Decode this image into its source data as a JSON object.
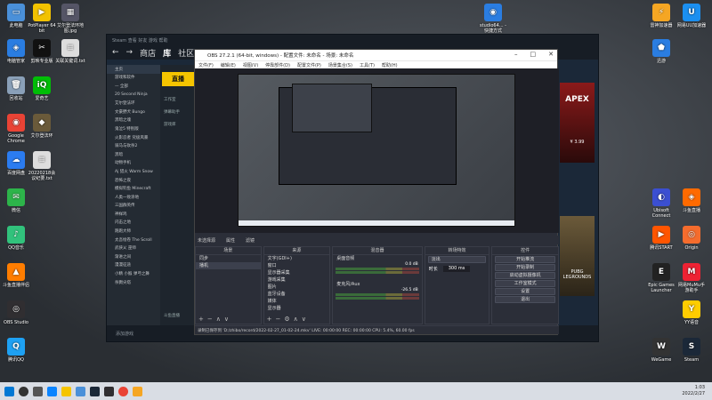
{
  "desktop_left": [
    {
      "label": "此电脑",
      "color": "#4a90d9",
      "glyph": "▭"
    },
    {
      "label": "电脑管家",
      "color": "#2a7de1",
      "glyph": "◈"
    },
    {
      "label": "回收站",
      "color": "#8aa0b8",
      "glyph": "🗑"
    },
    {
      "label": "Google Chrome",
      "color": "#e94335",
      "glyph": "◉"
    },
    {
      "label": "百度网盘",
      "color": "#2b7cf0",
      "glyph": "☁"
    },
    {
      "label": "微信",
      "color": "#2db44a",
      "glyph": "✉"
    },
    {
      "label": "QQ音乐",
      "color": "#31c27c",
      "glyph": "♪"
    },
    {
      "label": "斗鱼直播伴侣",
      "color": "#ff7d00",
      "glyph": "▲"
    },
    {
      "label": "OBS Studio",
      "color": "#302e31",
      "glyph": "◎"
    },
    {
      "label": "腾讯QQ",
      "color": "#1ea1f3",
      "glyph": "Q"
    }
  ],
  "desktop_col2": [
    {
      "label": "PotPlayer 64 bit",
      "color": "#f2c200",
      "glyph": "▶"
    },
    {
      "label": "剪映专业版",
      "color": "#111",
      "glyph": "✂"
    },
    {
      "label": "爱奇艺",
      "color": "#00be06",
      "glyph": "iQ"
    },
    {
      "label": "艾尔登法环",
      "color": "#6a5a3a",
      "glyph": "◆"
    },
    {
      "label": "20220218会议纪要.txt",
      "color": "#ddd",
      "glyph": "≡"
    }
  ],
  "desktop_col3": [
    {
      "label": "艾尔登法环地图.jpg",
      "color": "#556",
      "glyph": "▦"
    },
    {
      "label": "关联关键词.txt",
      "color": "#ddd",
      "glyph": "≡"
    }
  ],
  "desktop_right": [
    {
      "label": "雷神加速器",
      "color": "#f5a623",
      "glyph": "⚡"
    },
    {
      "label": "网易UU加速器",
      "color": "#1b8ff0",
      "glyph": "U"
    },
    {
      "label": "迅游",
      "color": "#2a7de1",
      "glyph": "⬟"
    },
    {
      "label": "Ubisoft Connect",
      "color": "#3b4fd1",
      "glyph": "◐"
    },
    {
      "label": "斗鱼直播",
      "color": "#ff6a00",
      "glyph": "◈"
    },
    {
      "label": "腾讯START",
      "color": "#ff5500",
      "glyph": "▶"
    },
    {
      "label": "Origin",
      "color": "#f56c2d",
      "glyph": "◎"
    },
    {
      "label": "Epic Games Launcher",
      "color": "#222",
      "glyph": "E"
    },
    {
      "label": "网易MuMu手游助手",
      "color": "#e23",
      "glyph": "M"
    },
    {
      "label": "YY语音",
      "color": "#ffcc00",
      "glyph": "Y"
    },
    {
      "label": "WeGame",
      "color": "#333",
      "glyph": "W"
    },
    {
      "label": "Steam",
      "color": "#1b2838",
      "glyph": "S"
    }
  ],
  "desktop_top_mid": {
    "label": "studio64... - 快捷方式"
  },
  "steam": {
    "nav": [
      "←",
      "→",
      "商店",
      "库",
      "社区"
    ],
    "home": "主页",
    "filter": "游戏和软件",
    "all_label": "— 全部",
    "games": [
      "20 Second Ninja",
      "艾尔登法环",
      "文豪野犬 Bungo",
      "黑暗之魂",
      "鬼泣5 特别版",
      "火影忍者 究极风暴",
      "骑马与砍杀2",
      "黑暗",
      "动物手机",
      "Aj 猎火 Warm Snow",
      "恐怖之夜",
      "模拟钓鱼 Minecraft",
      "人类一败涂地",
      "三国群英传",
      "神样鸡",
      "闪击之地",
      "跑跑大师",
      "太吾绘卷 The Scroll",
      "武侠乂 巫师",
      "渐进之间",
      "漫漫征途",
      "小精 小猴 弹弓之舞",
      "杀戮尖塔"
    ],
    "mid_items": [
      "直播",
      "工作室",
      "弹幕助手",
      "游戏库",
      "斗鱼直播"
    ],
    "bottom": "添加游戏",
    "ad_title": "APEX",
    "ad_price": "¥ 3.99",
    "ad_sub": "PUBG LEGROUNDS"
  },
  "obs": {
    "title": "OBS 27.2.1 (64-bit, windows) - 配置文件: 未命名 - 场景: 未命名",
    "menu": [
      "文件(F)",
      "编辑(E)",
      "视图(V)",
      "停靠部件(D)",
      "配置文件(P)",
      "场景集合(S)",
      "工具(T)",
      "帮助(H)"
    ],
    "scene_bar": [
      "未选择源",
      "属性",
      "滤镜"
    ],
    "scenes": {
      "header": "场景",
      "items": [
        "同步",
        "播机"
      ]
    },
    "sources": {
      "header": "来源",
      "items": [
        "文字(GDI+)",
        "窗口",
        "显示器采集",
        "游戏采集",
        "图片",
        "蓝牙设备",
        "媒体",
        "显示器"
      ]
    },
    "mixer": {
      "header": "混音器",
      "tracks": [
        {
          "name": "桌面音频",
          "db": "0.0 dB"
        },
        {
          "name": "麦克风/Aux",
          "db": "-26.5 dB"
        }
      ]
    },
    "transitions": {
      "header": "转场特效",
      "type": "淡出",
      "duration_label": "时长",
      "duration": "300 ms"
    },
    "controls": {
      "header": "控件",
      "buttons": [
        "开始推流",
        "开始录制",
        "启动虚拟摄像机",
        "工作室模式",
        "设置",
        "退出"
      ]
    },
    "status": "录制已保存到 'D:/zhibo/record/2022-02-27_01-02-24.mkv'    LIVE: 00:00:00    REC: 00:00:00    CPU: 5.4%, 60.00 fps"
  },
  "clock": {
    "time": "1:03",
    "date": "2022/2/27"
  }
}
